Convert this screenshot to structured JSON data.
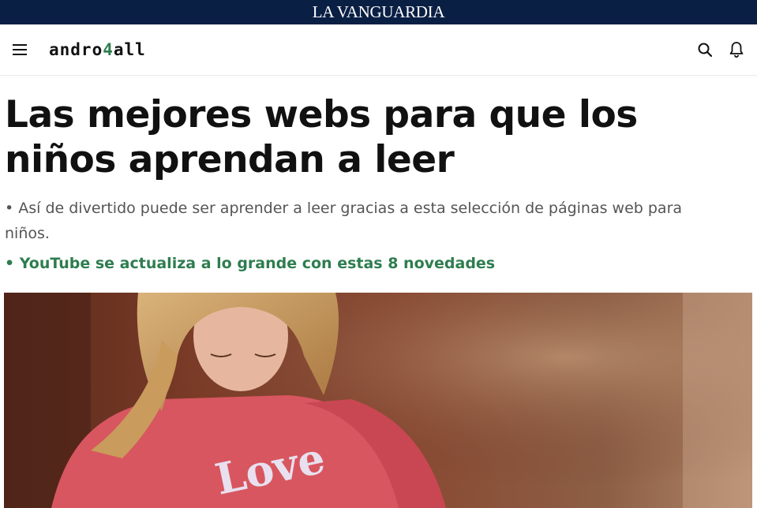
{
  "topbar": {
    "brand": "LA VANGUARDIA"
  },
  "header": {
    "logo_prefix": "andro",
    "logo_four": "4",
    "logo_suffix": "all",
    "icons": [
      "menu-icon",
      "search-icon",
      "bell-icon"
    ]
  },
  "article": {
    "headline": "Las mejores webs para que los niños aprendan a leer",
    "subtitle": "• Así de divertido puede ser aprender a leer gracias a esta selección de páginas web para niños.",
    "related_link": "• YouTube se actualiza a lo grande con estas 8 novedades",
    "hero_sweater_text": "Love"
  },
  "colors": {
    "top_strip": "#0a1f44",
    "accent_green": "#2e7d4f",
    "headline": "#111111",
    "subtitle": "#555555"
  }
}
